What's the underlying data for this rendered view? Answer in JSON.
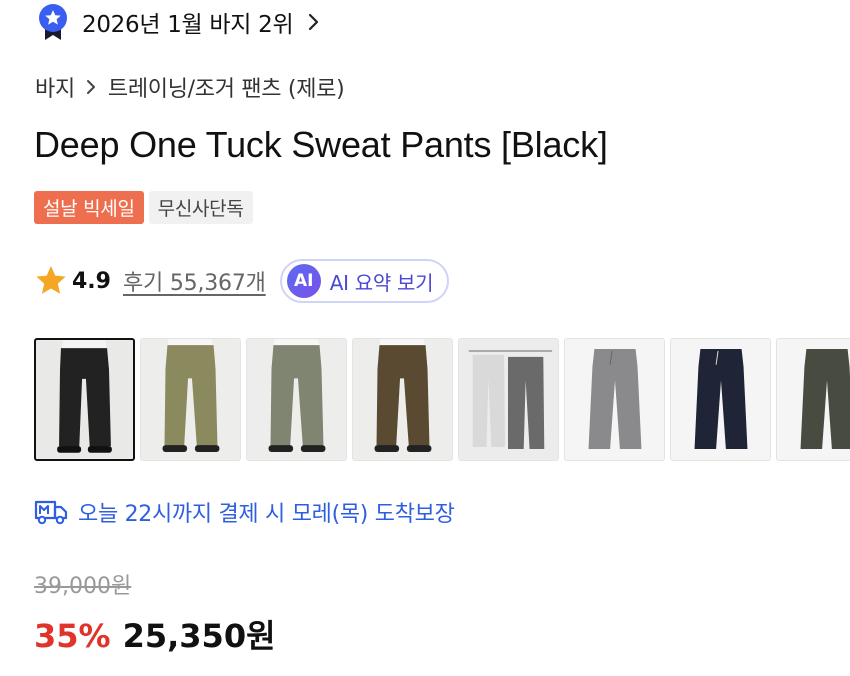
{
  "rank": {
    "label": "2026년 1월 바지 2위",
    "badge_icon": "ranking-badge-icon",
    "badge_color": "#3a5ff0"
  },
  "breadcrumb": {
    "category": "바지",
    "subcategory": "트레이닝/조거 팬츠 (제로)"
  },
  "product": {
    "title": "Deep One Tuck Sweat Pants [Black]"
  },
  "tags": [
    {
      "label": "설날 빅세일",
      "bg": "#ee6f4f"
    },
    {
      "label": "무신사단독",
      "bg": "#f1f1f1"
    }
  ],
  "rating": {
    "score": "4.9",
    "reviews_label": "후기 55,367개",
    "star_color": "#f5a623"
  },
  "ai_summary": {
    "badge": "AI",
    "label": "AI 요약 보기"
  },
  "thumbnails": [
    {
      "name": "black-worn",
      "color": "#2a2a2a",
      "selected": true
    },
    {
      "name": "olive-worn",
      "color": "#8a8a5e",
      "selected": false
    },
    {
      "name": "khaki-worn",
      "color": "#7f8570",
      "selected": false
    },
    {
      "name": "brown-worn",
      "color": "#5a4a32",
      "selected": false
    },
    {
      "name": "hanger-set",
      "color": "#9a9a9a",
      "selected": false
    },
    {
      "name": "grey-flat",
      "color": "#8a8a8c",
      "selected": false
    },
    {
      "name": "navy-flat",
      "color": "#1f2437",
      "selected": false
    },
    {
      "name": "darkolive-flat",
      "color": "#474b40",
      "selected": false
    }
  ],
  "delivery": {
    "icon": "truck-icon",
    "text": "오늘 22시까지 결제 시 모레(목) 도착보장",
    "color": "#2f5fe0"
  },
  "price": {
    "original": "39,000원",
    "discount": "35%",
    "final": "25,350원",
    "discount_color": "#e0342b"
  }
}
